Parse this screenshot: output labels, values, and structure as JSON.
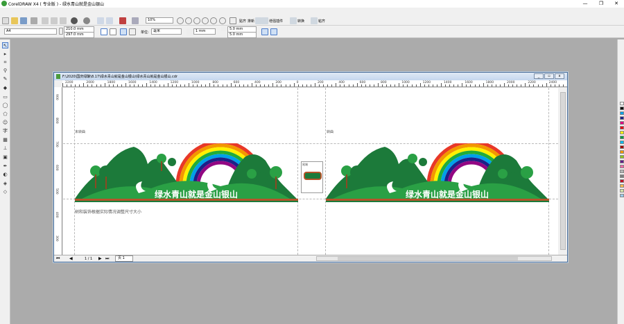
{
  "app": {
    "title": "CorelDRAW X4 ( 专业版 ) - 绿水青山就是金山银山",
    "min_btn": "—",
    "max_btn": "❐",
    "close_btn": "✕"
  },
  "toolbar1": {
    "zoom_value": "10%",
    "snap_label": "贴齐",
    "effects_label": "排新",
    "plugin_label": "增强插件",
    "convert_label": "转换",
    "stick_label": "粘齐"
  },
  "property_bar": {
    "page_size": "A4",
    "width": "210.0 mm",
    "height": "297.0 mm",
    "units_label": "单位:",
    "units_value": "毫米",
    "nudge": "1 mm",
    "dup_x": "5.0 mm",
    "dup_y": "5.0 mm"
  },
  "document": {
    "title": "F:\\2020\\国庆绿酿\\8.17\\绿水青山就是金山银山\\绿水青山就是金山银山.cdr",
    "ruler_ticks": [
      "2200",
      "2000",
      "1800",
      "1600",
      "1400",
      "1200",
      "1000",
      "800",
      "600",
      "400",
      "200",
      "0",
      "200",
      "400",
      "600",
      "800",
      "1000",
      "1200",
      "1400",
      "1600",
      "1800",
      "2000",
      "2200",
      "2400"
    ],
    "left_ruler_ticks": [
      "900",
      "800",
      "700",
      "600",
      "500",
      "400",
      "300"
    ],
    "left_panel_label": "未转曲",
    "right_panel_label": "转曲",
    "slogan": "绿水青山就是金山银山",
    "note": "树和装饰根据实际情况调整尺寸大小",
    "thumb_label": "尾端",
    "page_indicator": "1 / 1",
    "page_tab": "页 1"
  },
  "colors": {
    "grass": "#2aa045",
    "dark_green": "#1c7a3a",
    "soil": "#b5542a",
    "trunk": "#8a4a23",
    "rainbow": [
      "#e83828",
      "#f39800",
      "#fff100",
      "#22ac38",
      "#00a0e9",
      "#1d2088",
      "#920783"
    ]
  },
  "palette": [
    "#ffffff",
    "#000000",
    "#00a0e9",
    "#1d2088",
    "#e4007f",
    "#e60012",
    "#fff100",
    "#009944",
    "#00b7ee",
    "#a40000",
    "#f39800",
    "#8fc31f",
    "#601986",
    "#ea68a2",
    "#b3b3b3",
    "#7d7d7d",
    "#c30d23",
    "#f8b551",
    "#d3e2a6",
    "#9ac9e9"
  ]
}
